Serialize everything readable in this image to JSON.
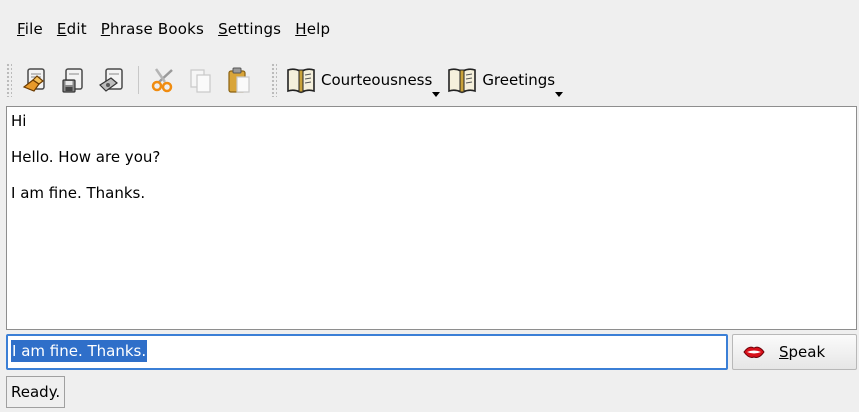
{
  "menubar": {
    "items": [
      {
        "mnemonic": "F",
        "rest": "ile"
      },
      {
        "mnemonic": "E",
        "rest": "dit"
      },
      {
        "mnemonic": "P",
        "rest": "hrase Books"
      },
      {
        "mnemonic": "S",
        "rest": "ettings"
      },
      {
        "mnemonic": "H",
        "rest": "elp"
      }
    ]
  },
  "toolbar": {
    "icons": [
      "open-file-icon",
      "save-file-icon",
      "save-as-file-icon",
      "cut-icon",
      "copy-icon",
      "paste-icon"
    ],
    "phrase_books": [
      {
        "label": "Courteousness",
        "icon": "phrase-book-icon"
      },
      {
        "label": "Greetings",
        "icon": "phrase-book-icon"
      }
    ]
  },
  "history": {
    "lines": [
      "Hi",
      "Hello. How are you?",
      "I am fine. Thanks."
    ]
  },
  "input": {
    "value": "I am fine. Thanks.",
    "accent_color": "#2f6fc9"
  },
  "speak_button": {
    "mnemonic": "S",
    "rest": "peak",
    "icon": "lips-icon"
  },
  "status": {
    "text": "Ready."
  }
}
